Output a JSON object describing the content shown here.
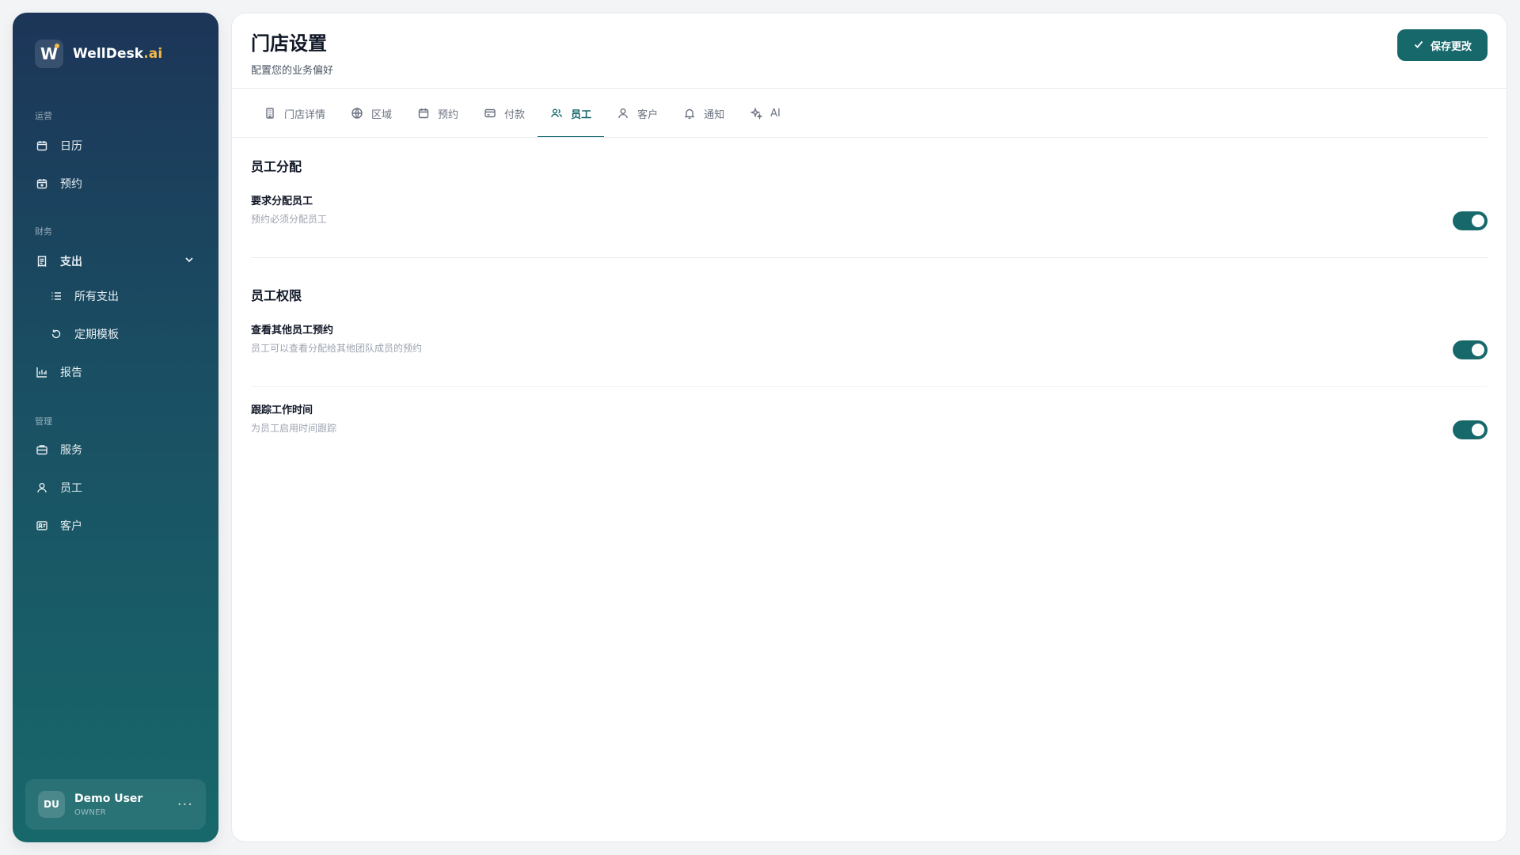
{
  "brand": {
    "initial": "W",
    "name_main": "WellDesk",
    "name_accent": ".ai"
  },
  "sidebar": {
    "sections": {
      "ops": "运营",
      "finance": "财务",
      "manage": "管理"
    },
    "items": {
      "calendar": "日历",
      "appointments": "预约",
      "expenses": "支出",
      "all_expenses": "所有支出",
      "recurring_templates": "定期模板",
      "reports": "报告",
      "services": "服务",
      "staff": "员工",
      "clients": "客户"
    }
  },
  "user": {
    "initials": "DU",
    "name": "Demo User",
    "role": "OWNER"
  },
  "header": {
    "title": "门店设置",
    "subtitle": "配置您的业务偏好",
    "save_label": "保存更改"
  },
  "tabs": [
    {
      "label": "门店详情",
      "icon": "building-icon",
      "active": false
    },
    {
      "label": "区域",
      "icon": "globe-icon",
      "active": false
    },
    {
      "label": "预约",
      "icon": "calendar-icon",
      "active": false
    },
    {
      "label": "付款",
      "icon": "card-icon",
      "active": false
    },
    {
      "label": "员工",
      "icon": "users-icon",
      "active": true
    },
    {
      "label": "客户",
      "icon": "user-icon",
      "active": false
    },
    {
      "label": "通知",
      "icon": "bell-icon",
      "active": false
    },
    {
      "label": "AI",
      "icon": "sparkles-icon",
      "active": false
    }
  ],
  "settings": {
    "assignment": {
      "title": "员工分配",
      "require_staff": {
        "title": "要求分配员工",
        "desc": "预约必须分配员工",
        "enabled": true
      }
    },
    "permissions": {
      "title": "员工权限",
      "view_others": {
        "title": "查看其他员工预约",
        "desc": "员工可以查看分配给其他团队成员的预约",
        "enabled": true
      },
      "track_time": {
        "title": "跟踪工作时间",
        "desc": "为员工启用时间跟踪",
        "enabled": true
      }
    }
  },
  "colors": {
    "accent": "#17686b",
    "sidebar_top": "#1c3558",
    "sidebar_bottom": "#17686b",
    "brand_accent": "#f5b84a"
  }
}
